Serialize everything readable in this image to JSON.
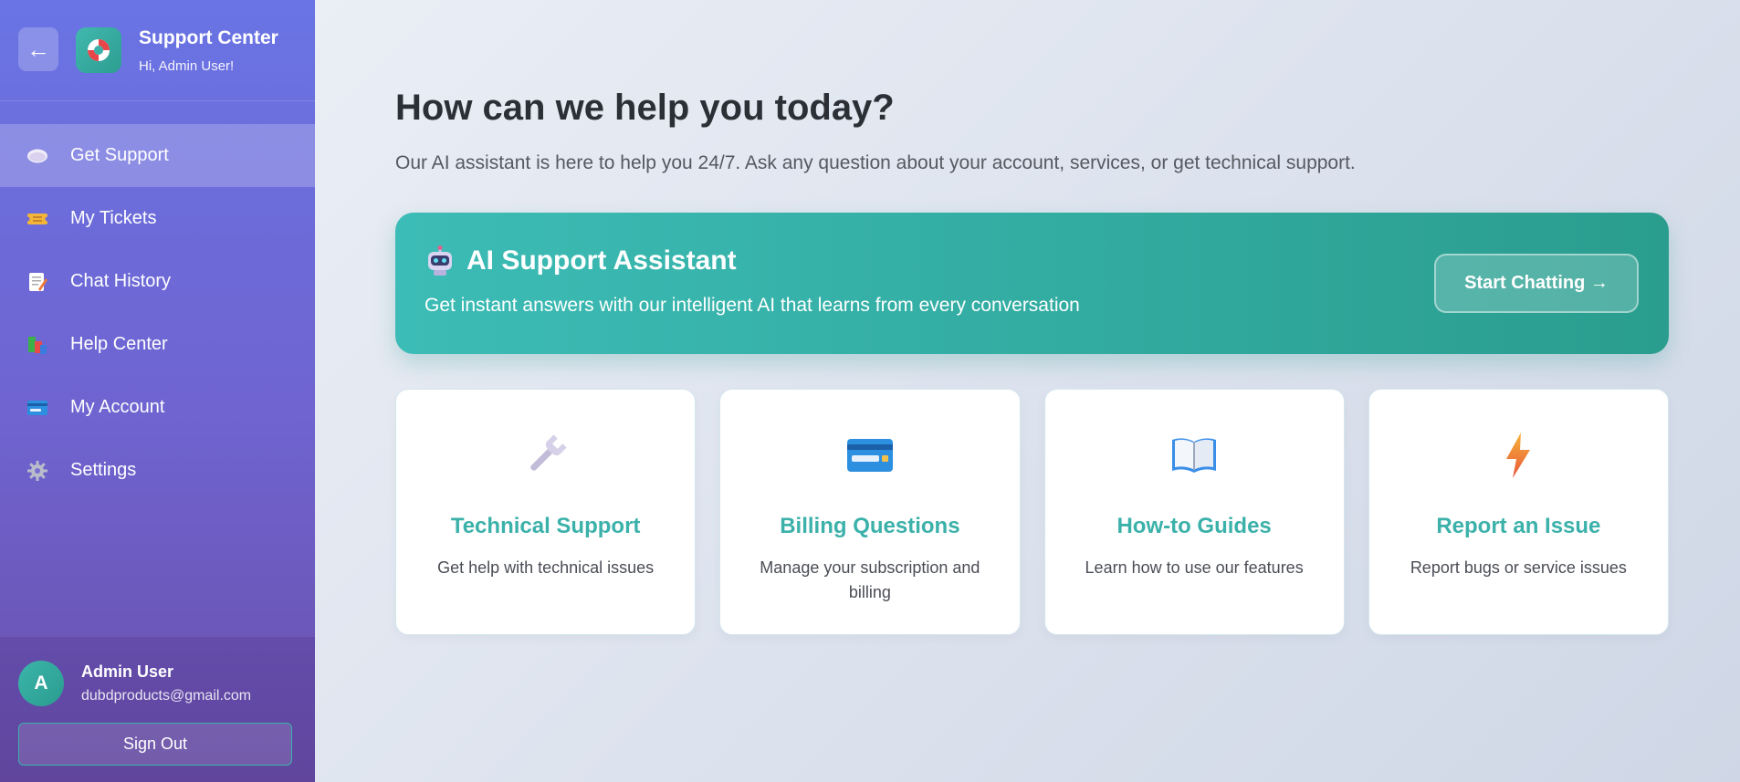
{
  "sidebar": {
    "back_label": "←",
    "title": "Support Center",
    "greeting": "Hi, Admin User!",
    "items": [
      {
        "label": "Get Support",
        "icon": "speech-bubble-icon",
        "active": true
      },
      {
        "label": "My Tickets",
        "icon": "ticket-icon"
      },
      {
        "label": "Chat History",
        "icon": "memo-icon"
      },
      {
        "label": "Help Center",
        "icon": "books-icon"
      },
      {
        "label": "My Account",
        "icon": "credit-card-icon"
      },
      {
        "label": "Settings",
        "icon": "gear-icon"
      }
    ],
    "user": {
      "avatar_initial": "A",
      "name": "Admin User",
      "email": "dubdproducts@gmail.com"
    },
    "sign_out_label": "Sign Out"
  },
  "main": {
    "title": "How can we help you today?",
    "subtitle": "Our AI assistant is here to help you 24/7. Ask any question about your account, services, or get technical support.",
    "banner": {
      "title": "AI Support Assistant",
      "subtitle": "Get instant answers with our intelligent AI that learns from every conversation",
      "button_label": "Start Chatting →"
    },
    "cards": [
      {
        "title": "Technical Support",
        "description": "Get help with technical issues",
        "icon": "wrench-icon"
      },
      {
        "title": "Billing Questions",
        "description": "Manage your subscription and billing",
        "icon": "credit-card-icon"
      },
      {
        "title": "How-to Guides",
        "description": "Learn how to use our features",
        "icon": "open-book-icon"
      },
      {
        "title": "Report an Issue",
        "description": "Report bugs or service issues",
        "icon": "lightning-icon"
      }
    ]
  },
  "colors": {
    "accent": "#3bb1aa",
    "sidebar_top": "#6a74e4",
    "sidebar_bottom": "#6a4fa8",
    "banner_start": "#3cbcb6",
    "banner_end": "#2a9d8e"
  }
}
